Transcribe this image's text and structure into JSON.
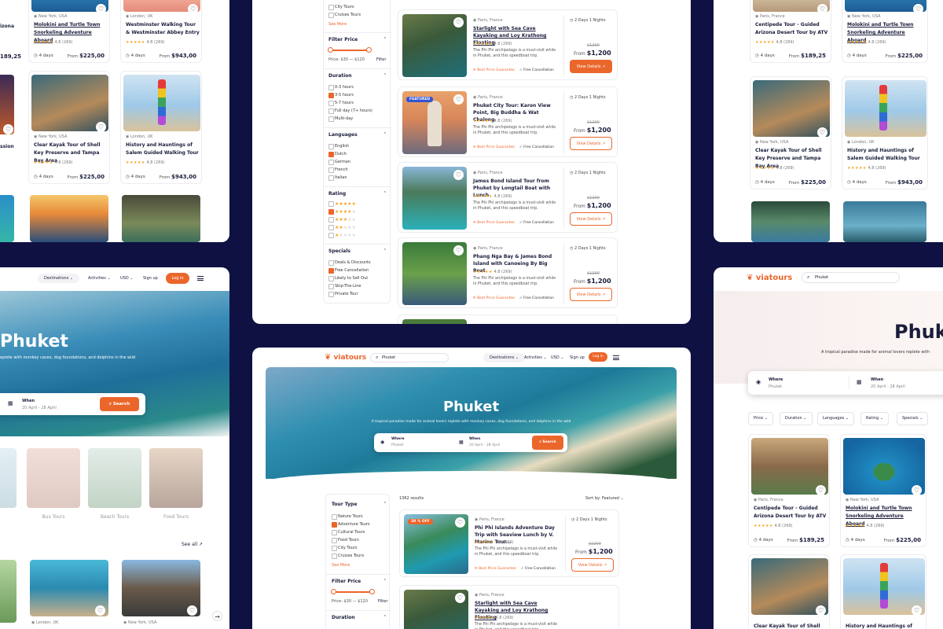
{
  "brand": {
    "name": "viatours",
    "accent": "#eb662b",
    "navy": "#0f1142"
  },
  "nav": {
    "destinations": "Destinations",
    "activities": "Activities",
    "currency": "USD",
    "signup": "Sign up",
    "login": "Log in"
  },
  "hero": {
    "title": "Phuket",
    "subtitle": "A tropical paradise made for animal lovers replete with monkey caves, dog foundations, and dolphins in the wild",
    "tagline_right": "A tropical paradise made for animal lovers replete with",
    "tagline_left": "eplete with monkey caves, dog foundations, and dolphins in the wild"
  },
  "search": {
    "query": "Phuket",
    "where_label": "Where",
    "where_value": "Phuket",
    "when_label": "When",
    "when_value": "20 April - 28 April",
    "button": "Search"
  },
  "results": {
    "count": "1362 results",
    "sort": "Sort by: Featured"
  },
  "filters": {
    "tour_type": {
      "title": "Tour Type",
      "items": [
        "Nature Tours",
        "Adventure Tours",
        "Cultural Tours",
        "Food Tours",
        "City Tours",
        "Cruises Tours"
      ],
      "see_more": "See More"
    },
    "price": {
      "title": "Filter Price",
      "range": "Price: $30 — $120",
      "action": "Filter"
    },
    "duration": {
      "title": "Duration",
      "items": [
        "0-3 hours",
        "3-5 hours",
        "5-7 hours",
        "Full day (7+ hours)",
        "Multi-day"
      ]
    },
    "languages": {
      "title": "Languages",
      "items": [
        "English",
        "Dutch",
        "German",
        "French",
        "Italian"
      ]
    },
    "rating": {
      "title": "Rating"
    },
    "specials": {
      "title": "Specials",
      "items": [
        "Deals & Discounts",
        "Free Cancellation",
        "Likely to Sell Out",
        "Skip-The-Line",
        "Private Tour"
      ]
    }
  },
  "chips": [
    "Price",
    "Duration",
    "Languages",
    "Rating",
    "Specials"
  ],
  "categories": [
    "Bus Tours",
    "Beach Tours",
    "Food Tours"
  ],
  "see_all": "See all",
  "tour_cards": [
    {
      "loc": "New York, USA",
      "title": "Molokini and Turtle Town Snorkeling Adventure Aboard",
      "rating": "4.8 (269)",
      "days": "4 days",
      "price": "$225,00"
    },
    {
      "loc": "London, UK",
      "title": "Westminster Walking Tour & Westminster Abbey Entry",
      "rating": "4.8 (269)",
      "days": "4 days",
      "price": "$943,00"
    },
    {
      "loc": "New York, USA",
      "title": "Clear Kayak Tour of Shell Key Preserve and Tampa Bay Area",
      "rating": "4.8 (269)",
      "days": "4 days",
      "price": "$225,00"
    },
    {
      "loc": "London, UK",
      "title": "History and Hauntings of Salem Guided Walking Tour",
      "rating": "4.8 (269)",
      "days": "4 days",
      "price": "$943,00"
    },
    {
      "loc": "Paris, France",
      "title": "Centipede Tour - Guided Arizona Desert Tour by ATV",
      "rating": "4.8 (269)",
      "days": "4 days",
      "price": "$189,25"
    }
  ],
  "tl_left": {
    "edge_title": "izona",
    "edge_price": "189,25",
    "edge_text": "ssion"
  },
  "list_cards": [
    {
      "loc": "Paris, France",
      "title": "Starlight with Sea Cave Kayaking and Loy Krathong Floating",
      "rating": "4.8 (269)",
      "desc": "The Phi Phi archipelago is a must-visit while in Phuket, and this speedboat trip.",
      "dur": "2 Days 1 Nights",
      "old": "$1200",
      "price": "$1,200",
      "badge": ""
    },
    {
      "loc": "Paris, France",
      "title": "Phuket City Tour: Karon View Point, Big Buddha & Wat Chalong",
      "rating": "4.8 (269)",
      "desc": "The Phi Phi archipelago is a must-visit while in Phuket, and this speedboat trip.",
      "dur": "2 Days 1 Nights",
      "old": "$1200",
      "price": "$1,200",
      "badge": "FEATURED"
    },
    {
      "loc": "Paris, France",
      "title": "James Bond Island Tour from Phuket by Longtail Boat with Lunch",
      "rating": "4.8 (269)",
      "desc": "The Phi Phi archipelago is a must-visit while in Phuket, and this speedboat trip.",
      "dur": "2 Days 1 Nights",
      "old": "$1200",
      "price": "$1,200",
      "badge": ""
    },
    {
      "loc": "Paris, France",
      "title": "Phang Nga Bay & James Bond Island with Canoeing By Big Boat",
      "rating": "4.8 (269)",
      "desc": "The Phi Phi archipelago is a must-visit while in Phuket, and this speedboat trip.",
      "dur": "2 Days 1 Nights",
      "old": "$1200",
      "price": "$1,200",
      "badge": ""
    },
    {
      "loc": "Paris, France",
      "title": "Phi Phi Islands Adventure Day Trip with Seaview Lunch by V. Marine Tour...",
      "rating": "4.8 (269)",
      "desc": "The Phi Phi archipelago is a must-visit while in Phuket, and this speedboat trip.",
      "dur": "2 Days 1 Nights",
      "old": "$1200",
      "price": "$1,200",
      "badge": "20 % OFF"
    }
  ],
  "labels": {
    "from": "From",
    "best_price": "Best Price Guarantee",
    "free_cancel": "Free Cancellation",
    "view_details": "View Details",
    "stars": "★★★★★"
  },
  "mr_bottom": [
    {
      "loc": "London, UK"
    },
    {
      "loc": "New York, USA"
    }
  ]
}
